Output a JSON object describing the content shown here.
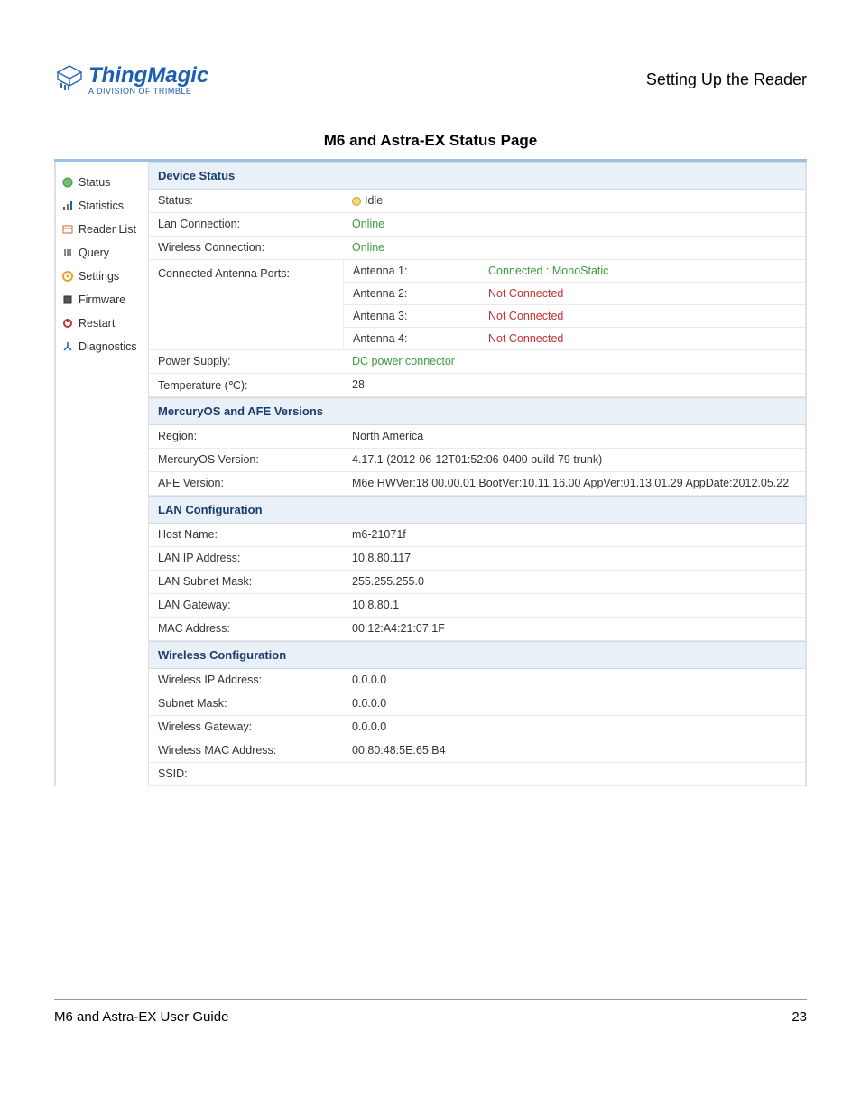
{
  "header": {
    "brand": "ThingMagic",
    "tagline": "A DIVISION OF TRIMBLE",
    "right": "Setting Up the Reader"
  },
  "title": "M6 and Astra-EX Status Page",
  "nav": [
    {
      "label": "Status",
      "icon": "status"
    },
    {
      "label": "Statistics",
      "icon": "stats"
    },
    {
      "label": "Reader List",
      "icon": "list"
    },
    {
      "label": "Query",
      "icon": "query"
    },
    {
      "label": "Settings",
      "icon": "gear"
    },
    {
      "label": "Firmware",
      "icon": "firmware"
    },
    {
      "label": "Restart",
      "icon": "restart"
    },
    {
      "label": "Diagnostics",
      "icon": "diag"
    }
  ],
  "sections": {
    "device_status": {
      "header": "Device Status",
      "status_label": "Status:",
      "status_value": "Idle",
      "lan_label": "Lan Connection:",
      "lan_value": "Online",
      "wireless_label": "Wireless Connection:",
      "wireless_value": "Online",
      "ports_label": "Connected Antenna Ports:",
      "antennas": [
        {
          "label": "Antenna 1:",
          "value": "Connected : MonoStatic",
          "status": "green"
        },
        {
          "label": "Antenna 2:",
          "value": "Not Connected",
          "status": "red"
        },
        {
          "label": "Antenna 3:",
          "value": "Not Connected",
          "status": "red"
        },
        {
          "label": "Antenna 4:",
          "value": "Not Connected",
          "status": "red"
        }
      ],
      "power_label": "Power Supply:",
      "power_value": "DC power connector",
      "temp_label": "Temperature (℃):",
      "temp_value": "28"
    },
    "versions": {
      "header": "MercuryOS and AFE Versions",
      "region_label": "Region:",
      "region_value": "North America",
      "mos_label": "MercuryOS Version:",
      "mos_value": "4.17.1 (2012-06-12T01:52:06-0400 build 79 trunk)",
      "afe_label": "AFE Version:",
      "afe_value": "M6e HWVer:18.00.00.01 BootVer:10.11.16.00 AppVer:01.13.01.29 AppDate:2012.05.22"
    },
    "lan": {
      "header": "LAN Configuration",
      "host_label": "Host Name:",
      "host_value": "m6-21071f",
      "ip_label": "LAN IP Address:",
      "ip_value": "10.8.80.117",
      "subnet_label": "LAN Subnet Mask:",
      "subnet_value": "255.255.255.0",
      "gw_label": "LAN Gateway:",
      "gw_value": "10.8.80.1",
      "mac_label": "MAC Address:",
      "mac_value": "00:12:A4:21:07:1F"
    },
    "wireless": {
      "header": "Wireless Configuration",
      "ip_label": "Wireless IP Address:",
      "ip_value": "0.0.0.0",
      "subnet_label": "Subnet Mask:",
      "subnet_value": "0.0.0.0",
      "gw_label": "Wireless Gateway:",
      "gw_value": "0.0.0.0",
      "mac_label": "Wireless MAC Address:",
      "mac_value": "00:80:48:5E:65:B4",
      "ssid_label": "SSID:",
      "ssid_value": ""
    }
  },
  "footer": {
    "left": "M6 and Astra-EX User Guide",
    "right": "23"
  },
  "icons": {
    "status": "#3a9a3a",
    "stats": "#c43030",
    "list": "#c46a30",
    "query": "#888",
    "gear": "#e8a030",
    "firmware": "#555",
    "restart": "#c43030",
    "diag": "#1a5fb4"
  }
}
